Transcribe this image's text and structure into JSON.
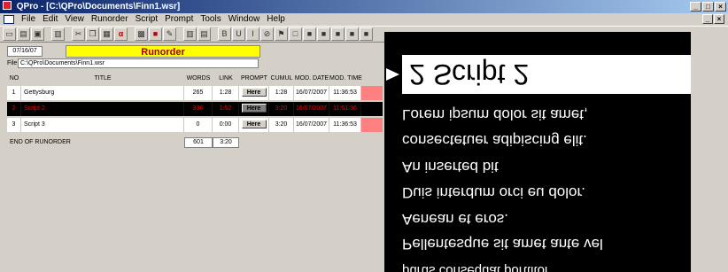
{
  "window": {
    "title": "QPro - [C:\\QPro\\Documents\\Finn1.wsr]",
    "min": "_",
    "restore": "□",
    "close": "×",
    "mdi_min": "_",
    "mdi_close": "×"
  },
  "menu": [
    "File",
    "Edit",
    "View",
    "Runorder",
    "Script",
    "Prompt",
    "Tools",
    "Window",
    "Help"
  ],
  "toolbar": {
    "buttons": [
      "new-icon",
      "open-icon",
      "save-icon",
      "print-icon",
      "cut-icon",
      "copy-icon",
      "paste-icon",
      "alpha-icon",
      "grid-icon",
      "red-icon",
      "edit-icon",
      "columns-icon",
      "table-icon",
      "bold-icon",
      "underline-icon",
      "italic-icon",
      "strike-icon",
      "format-icon",
      "box-icon",
      "black1-icon",
      "black2-icon",
      "black3-icon",
      "black4-icon",
      "black5-icon"
    ],
    "labels": {
      "bold": "B",
      "underline": "U",
      "italic": "I"
    }
  },
  "runorder": {
    "date": "07/16/07",
    "title": "Runorder",
    "file_label": "File",
    "file_path": "C:\\QPro\\Documents\\Finn1.wsr",
    "columns": [
      "NO",
      "TITLE",
      "WORDS",
      "LINK",
      "PROMPT",
      "CUMUL",
      "MOD. DATE",
      "MOD. TIME"
    ],
    "rows": [
      {
        "no": "1",
        "title": "Gettysburg",
        "words": "265",
        "link": "1:28",
        "prompt": "Here",
        "cumul": "1:28",
        "mod_date": "16/07/2007",
        "mod_time": "11:36:53",
        "selected": false
      },
      {
        "no": "2",
        "title": "Script 2",
        "words": "336",
        "link": "1:52",
        "prompt": "Here",
        "cumul": "3:20",
        "mod_date": "16/07/2007",
        "mod_time": "11:51:36",
        "selected": true
      },
      {
        "no": "3",
        "title": "Script 3",
        "words": "0",
        "link": "0:00",
        "prompt": "Here",
        "cumul": "3:20",
        "mod_date": "16/07/2007",
        "mod_time": "11:36:53",
        "selected": false
      }
    ],
    "footer": {
      "label": "END OF RUNORDER",
      "words": "601",
      "time": "3:20"
    },
    "row_ext_color": "#ff8080"
  },
  "prompter": {
    "cue": "2  Script 2",
    "lines": [
      "Lorem ipsum dolor sit amet,",
      "consectetuer adipiscing elit.",
      "An inserted bit",
      "Duis interdum orci eu dolor.",
      "Aenean et eros.",
      "Pellentesque sit amet ante vel",
      "purus consequat porttitor"
    ]
  },
  "colors": {
    "title_gradient_start": "#0a246a",
    "title_gradient_end": "#a6caf0",
    "runorder_title_bg": "#ffff00",
    "runorder_title_text": "#a00000",
    "selected_row_bg": "#000000",
    "selected_row_text": "#ff0000",
    "prompter_bg": "#000000",
    "prompter_text": "#ffffff"
  }
}
